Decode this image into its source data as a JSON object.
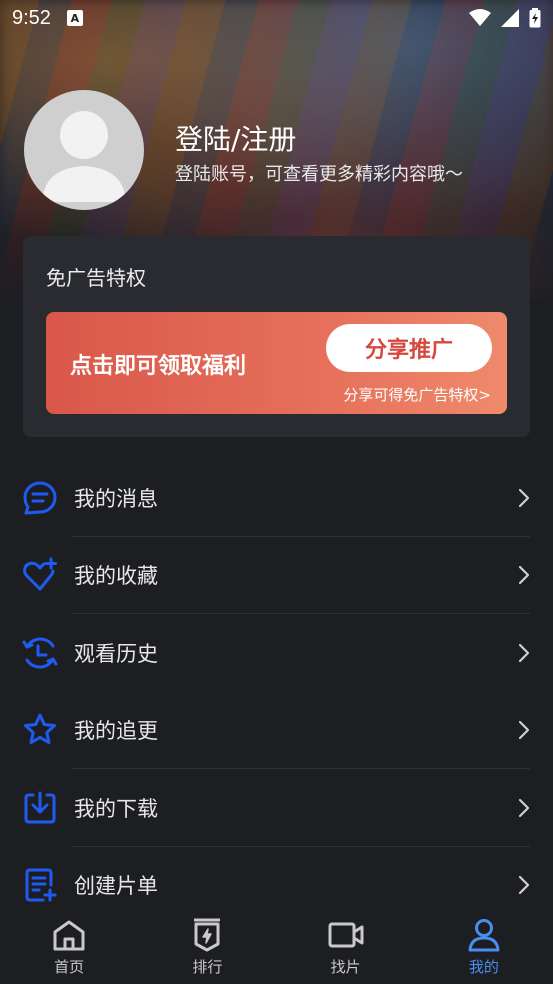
{
  "status_bar": {
    "time": "9:52",
    "notification_icon": "A"
  },
  "profile": {
    "name": "登陆/注册",
    "subtitle": "登陆账号，可查看更多精彩内容哦～"
  },
  "privilege": {
    "title": "免广告特权",
    "banner_text": "点击即可领取福利",
    "button_label": "分享推广",
    "hint": "分享可得免广告特权>"
  },
  "menu": [
    {
      "label": "我的消息",
      "icon": "message-icon"
    },
    {
      "label": "我的收藏",
      "icon": "favorite-heart-icon"
    },
    {
      "label": "观看历史",
      "icon": "history-icon"
    },
    {
      "label": "我的追更",
      "icon": "star-icon"
    },
    {
      "label": "我的下载",
      "icon": "download-icon"
    },
    {
      "label": "创建片单",
      "icon": "create-list-icon"
    }
  ],
  "tabs": [
    {
      "label": "首页",
      "icon": "home-icon",
      "active": false
    },
    {
      "label": "排行",
      "icon": "ranking-icon",
      "active": false
    },
    {
      "label": "找片",
      "icon": "video-camera-icon",
      "active": false
    },
    {
      "label": "我的",
      "icon": "profile-icon",
      "active": true
    }
  ],
  "colors": {
    "accent_blue": "#1f5bf0",
    "tab_active": "#4a8df0",
    "banner_red": "#d9574a",
    "background": "#1d1e22",
    "card": "#2a2b30"
  }
}
